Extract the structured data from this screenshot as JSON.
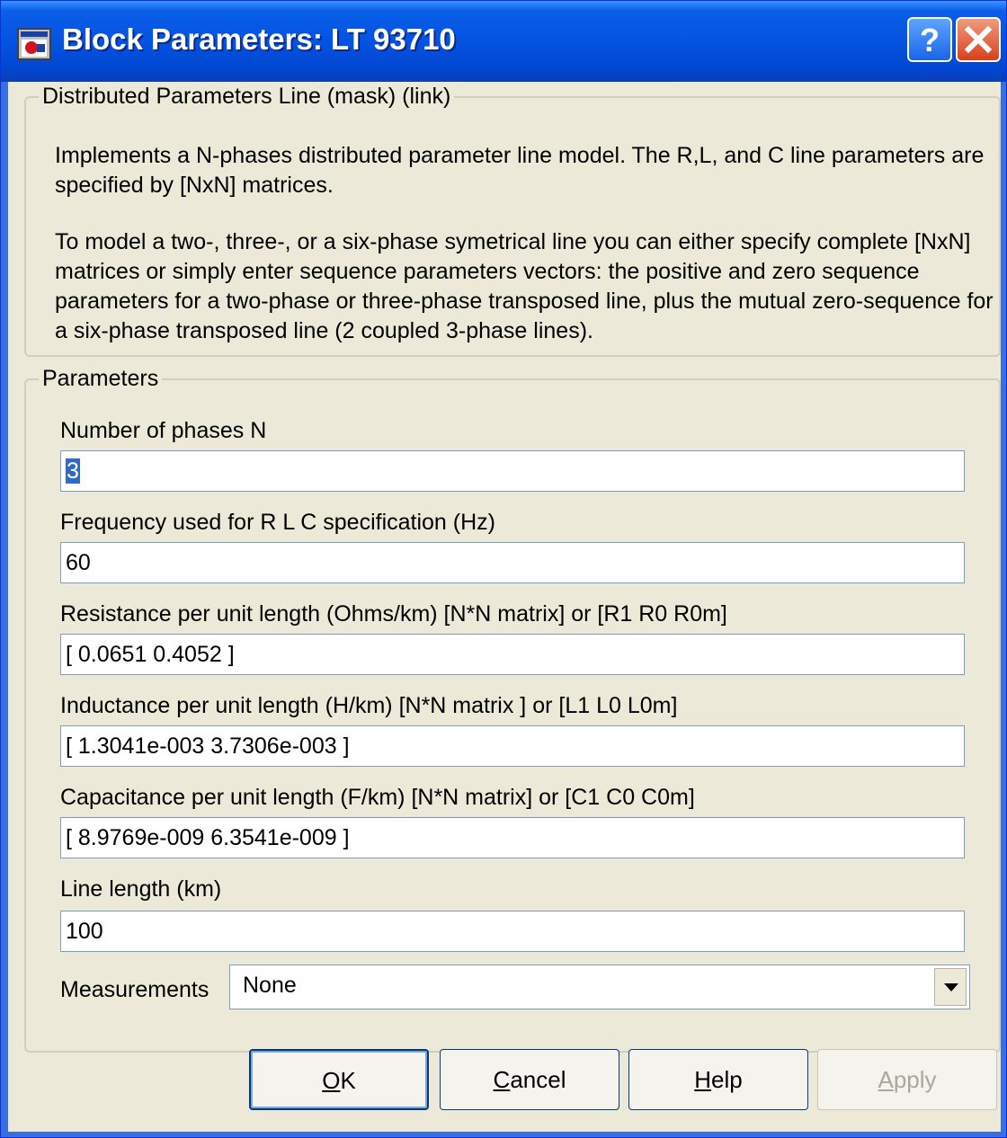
{
  "window": {
    "title": "Block Parameters: LT 93710",
    "help_glyph": "?",
    "close_icon": "close-x"
  },
  "description": {
    "legend": "Distributed Parameters Line (mask) (link)",
    "paragraph1": "Implements a N-phases distributed parameter line model. The R,L, and C line parameters are specified by [NxN] matrices.",
    "paragraph2": "To model a two-, three-, or a six-phase symetrical line you can either specify complete [NxN] matrices or simply enter sequence parameters vectors: the  positive and zero sequence parameters for a two-phase or  three-phase transposed  line, plus the mutual zero-sequence for a  six-phase transposed  line  (2 coupled 3-phase lines)."
  },
  "parameters": {
    "legend": "Parameters",
    "fields": [
      {
        "label": "Number of phases N",
        "value": "3"
      },
      {
        "label": "Frequency used for R L C specification (Hz)",
        "value": "60"
      },
      {
        "label": "Resistance per unit length (Ohms/km)   [N*N matrix] or [R1 R0 R0m]",
        "value": "[ 0.0651 0.4052 ]"
      },
      {
        "label": "Inductance per unit length (H/km) [N*N matrix ] or [L1 L0 L0m]",
        "value": "[ 1.3041e-003 3.7306e-003 ]"
      },
      {
        "label": "Capacitance per unit length (F/km) [N*N matrix] or [C1 C0 C0m]",
        "value": "[ 8.9769e-009 6.3541e-009 ]"
      },
      {
        "label": "Line length (km)",
        "value": "100"
      }
    ],
    "measurements": {
      "label": "Measurements",
      "selected": "None"
    }
  },
  "buttons": [
    {
      "mnemonic": "O",
      "rest": "K",
      "enabled": true
    },
    {
      "mnemonic": "C",
      "rest": "ancel",
      "enabled": true
    },
    {
      "mnemonic": "H",
      "rest": "elp",
      "enabled": true
    },
    {
      "mnemonic": "A",
      "rest": "pply",
      "enabled": false
    }
  ],
  "colors": {
    "titlebar": "#0553e2",
    "dialog_bg": "#ece9d8",
    "selection": "#316ac5",
    "close_button": "#d8401c"
  }
}
